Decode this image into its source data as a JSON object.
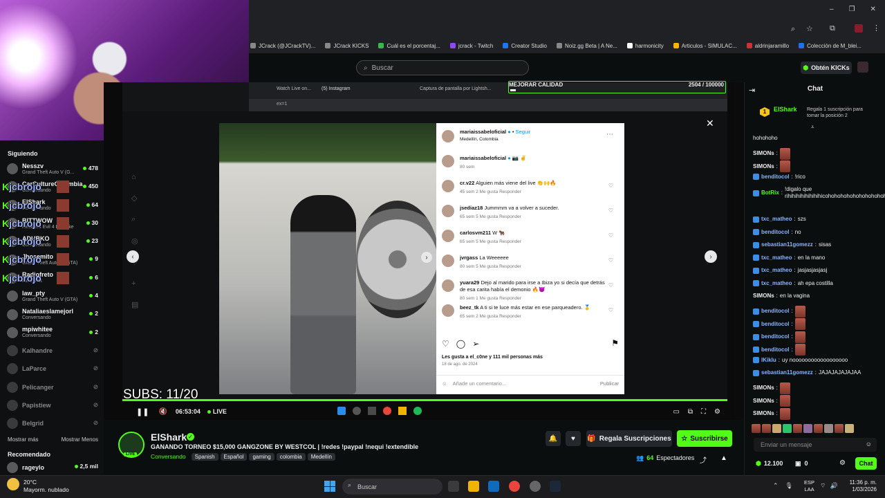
{
  "browser": {
    "bookmarks": [
      "JCrack (@JCrackTV)...",
      "JCrack KICKS",
      "Cuál es el porcentaj...",
      "jcrack - Twitch",
      "Creator Studio",
      "Noiz.gg Beta | A Ne...",
      "harmonicity",
      "Articulos - SIMULAC...",
      "aldrinjaramillo",
      "Colección de M_blei..."
    ]
  },
  "header": {
    "search_placeholder": "Buscar",
    "get_kicks": "Obtén KICKs"
  },
  "sidebar": {
    "following_title": "Siguiendo",
    "channels": [
      {
        "name": "Nesszv",
        "game": "Grand Theft Auto V (G...",
        "viewers": "478",
        "live": true
      },
      {
        "name": "CarCultureColombia",
        "game": "Conversando",
        "viewers": "450",
        "live": true
      },
      {
        "name": "ElShark",
        "game": "Conversando",
        "viewers": "64",
        "live": true
      },
      {
        "name": "BITTWOW",
        "game": "Resident Evil 4 Remake",
        "viewers": "30",
        "live": true
      },
      {
        "name": "ADUBKO",
        "game": "Conversando",
        "viewers": "23",
        "live": true
      },
      {
        "name": "Jhosemito",
        "game": "Grand Theft Auto V (GTA)",
        "viewers": "9",
        "live": true
      },
      {
        "name": "Radiofreto",
        "game": "Minecraft",
        "viewers": "6",
        "live": true
      },
      {
        "name": "law_pty",
        "game": "Grand Theft Auto V (GTA)",
        "viewers": "4",
        "live": true
      },
      {
        "name": "Nataliaeslamejorl",
        "game": "Conversando",
        "viewers": "2",
        "live": true
      },
      {
        "name": "mpiwhitee",
        "game": "Conversando",
        "viewers": "2",
        "live": true
      },
      {
        "name": "Kalhandre",
        "game": "",
        "viewers": "",
        "live": false
      },
      {
        "name": "LaParce",
        "game": "",
        "viewers": "",
        "live": false
      },
      {
        "name": "Pelicanger",
        "game": "",
        "viewers": "",
        "live": false
      },
      {
        "name": "Papistiew",
        "game": "",
        "viewers": "",
        "live": false
      },
      {
        "name": "Belgrid",
        "game": "",
        "viewers": "",
        "live": false
      }
    ],
    "overlay_name": "jcbrojo",
    "show_more": "Mostrar más",
    "show_less": "Mostrar Menos",
    "recommended_title": "Recomendado",
    "recommended": {
      "name": "rageylo",
      "viewers": "2,5 mil"
    }
  },
  "stream": {
    "inner_tabs": [
      "Watch Live on...",
      "(5) Instagram",
      "Captura de pantalla por Lightsh..."
    ],
    "inner_url": "ex=1",
    "mejorar_label": "MEJORAR CALIDAD",
    "mejorar_count": "2504 / 100000",
    "mejorar_progress": 0.025,
    "subs_overlay": "SUBS: 11/20",
    "time": "06:53:04",
    "live": "LIVE"
  },
  "instagram": {
    "author": "mariaissabeloficial",
    "follow": "Seguir",
    "location": "Medellín, Colombia",
    "caption_meta": "80 sem",
    "comments": [
      {
        "user": "cr.v22",
        "text": "Alguien más viene del live 👏🙌🔥",
        "meta": "45 sem   2 Me gusta   Responder"
      },
      {
        "user": "jsediaz18",
        "text": "Jummmm va a volver a suceder.",
        "meta": "65 sem   5 Me gusta   Responder"
      },
      {
        "user": "carlosvm211",
        "text": "W 🐂",
        "meta": "65 sem   5 Me gusta   Responder"
      },
      {
        "user": "jvrgass",
        "text": "La Weeeeee",
        "meta": "80 sem   5 Me gusta   Responder"
      },
      {
        "user": "yuara29",
        "text": "Dejo al marido para irse a Ibiza yo si decía que detrás de esa carita había el demonio 🔥😈",
        "meta": "80 sem   1 Me gusta   Responder"
      },
      {
        "user": "beez_tk",
        "text": "A ti si te luce más estar en ese parqueadero. 🥇",
        "meta": "65 sem   2 Me gusta   Responder"
      }
    ],
    "likes": "Les gusta a el_c0ne y 111 mil personas más",
    "date": "18 de ago. de 2024",
    "add_comment": "Añade un comentario...",
    "publish": "Publicar"
  },
  "channel": {
    "name": "ElShark",
    "title": "GANANDO TORNEO $15,000 GANGZONE BY WESTCOL | !redes !paypal !nequi !extendible",
    "category": "Conversando",
    "tags": [
      "Spanish",
      "Español",
      "gaming",
      "colombia",
      "Medellín"
    ],
    "gift_subs": "Regala Suscripciones",
    "subscribe": "Suscribirse",
    "viewers": "64",
    "viewers_label": "Espectadores",
    "live_badge": "LIVE"
  },
  "chat": {
    "title": "Chat",
    "pinned_user": "ElShark",
    "pinned_rank": "1",
    "pinned_text": "Regala 1 suscripción para tomar la posición 2",
    "messages": [
      {
        "user": "",
        "text": "hohohoho",
        "color": "#efeff1"
      },
      {
        "user": "SIMONs",
        "text": "",
        "color": "#efeff1",
        "emote": true
      },
      {
        "user": "SIMONs",
        "text": "",
        "color": "#efeff1",
        "emote": true
      },
      {
        "user": "benditocol",
        "text": "!rico",
        "color": "#8ab4ff"
      },
      {
        "user": "BotRix",
        "text": "!digalo que rihihihihihihihihicohohohohohohohohohohohohohohoho",
        "color": "#53fc18"
      },
      {
        "user": "txc_matheo",
        "text": "szs",
        "color": "#8ab4ff"
      },
      {
        "user": "benditocol",
        "text": "no",
        "color": "#8ab4ff"
      },
      {
        "user": "sebastian11gomezz",
        "text": "sisas",
        "color": "#8ab4ff"
      },
      {
        "user": "txc_matheo",
        "text": "en la mano",
        "color": "#8ab4ff"
      },
      {
        "user": "txc_matheo",
        "text": "jasjasjasjasj",
        "color": "#8ab4ff"
      },
      {
        "user": "txc_matheo",
        "text": "ah epa costilla",
        "color": "#8ab4ff"
      },
      {
        "user": "SIMONs",
        "text": "en la vagina",
        "color": "#efeff1"
      },
      {
        "user": "benditocol",
        "text": "",
        "color": "#8ab4ff",
        "emote": true
      },
      {
        "user": "benditocol",
        "text": "",
        "color": "#8ab4ff",
        "emote": true
      },
      {
        "user": "benditocol",
        "text": "",
        "color": "#8ab4ff",
        "emote": true
      },
      {
        "user": "benditocol",
        "text": "",
        "color": "#8ab4ff",
        "emote": true
      },
      {
        "user": "lKiklu",
        "text": "uy noooooooooooooooooo",
        "color": "#8ab4ff"
      },
      {
        "user": "sebastian11gomezz",
        "text": "JAJAJAJAJAJAA",
        "color": "#8ab4ff"
      },
      {
        "user": "SIMONs",
        "text": "",
        "color": "#efeff1",
        "emote": true
      },
      {
        "user": "SIMONs",
        "text": "",
        "color": "#efeff1",
        "emote": true
      },
      {
        "user": "SIMONs",
        "text": "",
        "color": "#efeff1",
        "emote": true
      }
    ],
    "input_placeholder": "Enviar un mensaje",
    "kicks_balance": "12.100",
    "gift_count": "0",
    "send": "Chat"
  },
  "taskbar": {
    "weather_temp": "20°C",
    "weather_desc": "Mayorm. nublado",
    "search": "Buscar",
    "lang1": "ESP",
    "lang2": "LAA",
    "time": "11:36 p. m.",
    "date": "1/03/2026"
  },
  "colors": {
    "kick_green": "#53fc18",
    "bg": "#0b0e0f"
  }
}
